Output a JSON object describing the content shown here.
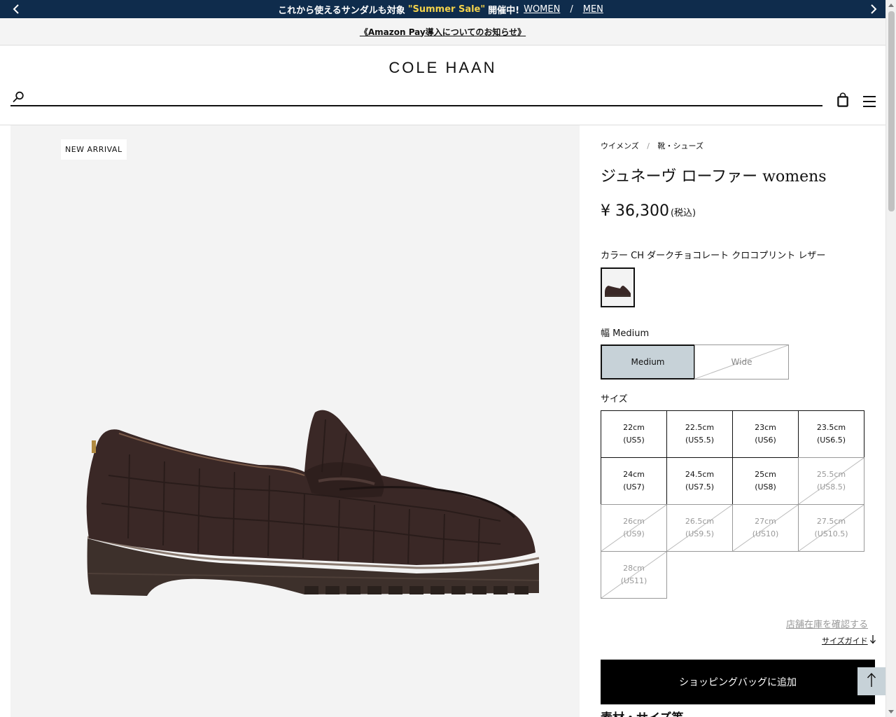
{
  "promo": {
    "text_before": "これから使えるサンダルも対象",
    "sale_name": "\"Summer Sale\"",
    "text_after": "開催中!",
    "women_link": "WOMEN",
    "separator": "/",
    "men_link": "MEN",
    "prev_icon": "chevron-left-icon",
    "next_icon": "chevron-right-icon",
    "background_color": "#0f2c4c",
    "accent_color": "#f3d24a"
  },
  "notice": {
    "text": "《Amazon Pay導入についてのお知らせ》"
  },
  "header": {
    "logo": "COLE HAAN",
    "search_icon": "search-icon",
    "search_placeholder": "",
    "bag_icon": "shopping-bag-icon",
    "menu_icon": "hamburger-menu-icon"
  },
  "media": {
    "badge": "NEW ARRIVAL"
  },
  "product": {
    "breadcrumb": [
      "ウイメンズ",
      "靴・シューズ"
    ],
    "breadcrumb_separator": "/",
    "title": "ジュネーヴ ローファー womens",
    "price": "¥ 36,300",
    "price_tax": "(税込)",
    "color_label": "カラー CH ダークチョコレート クロコプリント レザー",
    "width_label": "幅 Medium",
    "widths": [
      {
        "label": "Medium",
        "selected": true,
        "available": true
      },
      {
        "label": "Wide",
        "selected": false,
        "available": false
      }
    ],
    "size_label": "サイズ",
    "sizes": [
      {
        "cm": "22cm",
        "us": "(US5)",
        "available": true
      },
      {
        "cm": "22.5cm",
        "us": "(US5.5)",
        "available": true
      },
      {
        "cm": "23cm",
        "us": "(US6)",
        "available": true
      },
      {
        "cm": "23.5cm",
        "us": "(US6.5)",
        "available": true
      },
      {
        "cm": "24cm",
        "us": "(US7)",
        "available": true
      },
      {
        "cm": "24.5cm",
        "us": "(US7.5)",
        "available": true
      },
      {
        "cm": "25cm",
        "us": "(US8)",
        "available": true
      },
      {
        "cm": "25.5cm",
        "us": "(US8.5)",
        "available": false
      },
      {
        "cm": "26cm",
        "us": "(US9)",
        "available": false
      },
      {
        "cm": "26.5cm",
        "us": "(US9.5)",
        "available": false
      },
      {
        "cm": "27cm",
        "us": "(US10)",
        "available": false
      },
      {
        "cm": "27.5cm",
        "us": "(US10.5)",
        "available": false
      },
      {
        "cm": "28cm",
        "us": "(US11)",
        "available": false
      }
    ],
    "store_stock_link": "店舗在庫を確認する",
    "size_guide_link": "サイズガイド",
    "size_guide_icon": "arrow-down-icon",
    "add_to_bag": "ショッピングバッグに追加",
    "specs_heading": "素材・サイズ等",
    "selected_width_color": "#c7d2d8"
  },
  "back_to_top_icon": "arrow-up-icon"
}
